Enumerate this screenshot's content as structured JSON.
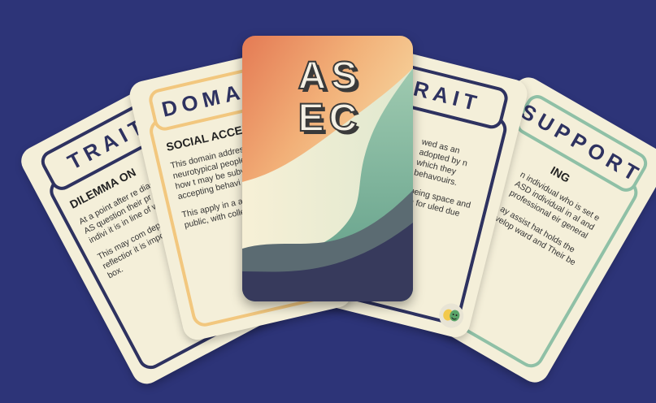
{
  "cards": {
    "trait_left": {
      "tab_title": "TRAIT",
      "heading": "DILEMMA ON",
      "paragraphs": [
        "At a point after re diagnosis, the AS question their pr their own indivi it is in line of w autistic.",
        "This may com depend on th self-reflectior it is importar are unique, box."
      ]
    },
    "domain": {
      "tab_title": "DOMAIN",
      "heading": "SOCIAL ACCEPT",
      "paragraphs": [
        "This domain address neurotypical people in regards to how t may be subverted accepting behavi their neurodiffer",
        "This apply in a and environm public, with colleagues"
      ]
    },
    "trait_right": {
      "tab_title": "TRAIT",
      "paragraphs": [
        "wed as an adopted by n which they behavouirs.",
        "being space and in for uled due"
      ]
    },
    "support": {
      "tab_title": "SUPPORT",
      "heading": "ING",
      "paragraphs": [
        "n individual who is set e ASD individual in al and professional eir general",
        "ay assist hat holds the velop ward and Their be"
      ]
    },
    "cover": {
      "logo_top": "AS",
      "logo_bottom": "EC"
    }
  },
  "colors": {
    "background": "#2d3478",
    "card": "#f4efd9",
    "navy": "#2e3260",
    "domain_accent": "#f2c77e",
    "support_accent": "#8fc0a6"
  },
  "icons": [
    "theatre-masks-icon",
    "people-support-icon"
  ]
}
